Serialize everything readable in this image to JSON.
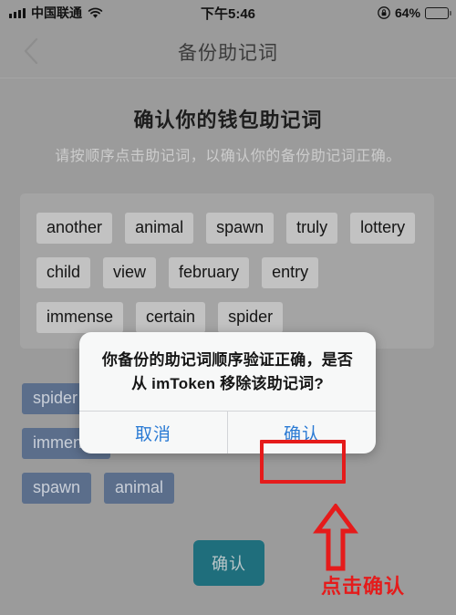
{
  "status_bar": {
    "signal_icon": "signal-bars-icon",
    "carrier": "中国联通",
    "wifi_icon": "wifi-icon",
    "time": "下午5:46",
    "rotation_lock_icon": "rotation-lock-icon",
    "battery_percent": "64%",
    "battery_level": 64,
    "battery_icon": "battery-icon"
  },
  "nav": {
    "back_icon": "back-chevron-icon",
    "title": "备份助记词"
  },
  "content": {
    "headline": "确认你的钱包助记词",
    "subline": "请按顺序点击助记词，以确认你的备份助记词正确。",
    "word_bank": {
      "rows": [
        [
          "another",
          "animal",
          "spawn",
          "truly",
          "lottery"
        ],
        [
          "child",
          "view",
          "february",
          "entry"
        ],
        [
          "immense",
          "certain",
          "spider"
        ]
      ]
    },
    "selected_words": {
      "rows": [
        [
          "spider"
        ],
        [
          "immense"
        ],
        [
          "spawn",
          "animal"
        ]
      ]
    },
    "primary_button": "确认"
  },
  "dialog": {
    "message": "你备份的助记词顺序验证正确，是否从 imToken 移除该助记词?",
    "cancel_label": "取消",
    "confirm_label": "确认"
  },
  "annotations": {
    "arrow_icon": "up-arrow-annotation-icon",
    "callout_text": "点击确认",
    "highlight_color": "#e51b1b"
  },
  "colors": {
    "background": "#9b9b9b",
    "primary_button": "#1f6e7c",
    "chip_selected": "#5b6e8b",
    "dialog_link": "#2a7ad4",
    "annotation": "#e51b1b"
  }
}
